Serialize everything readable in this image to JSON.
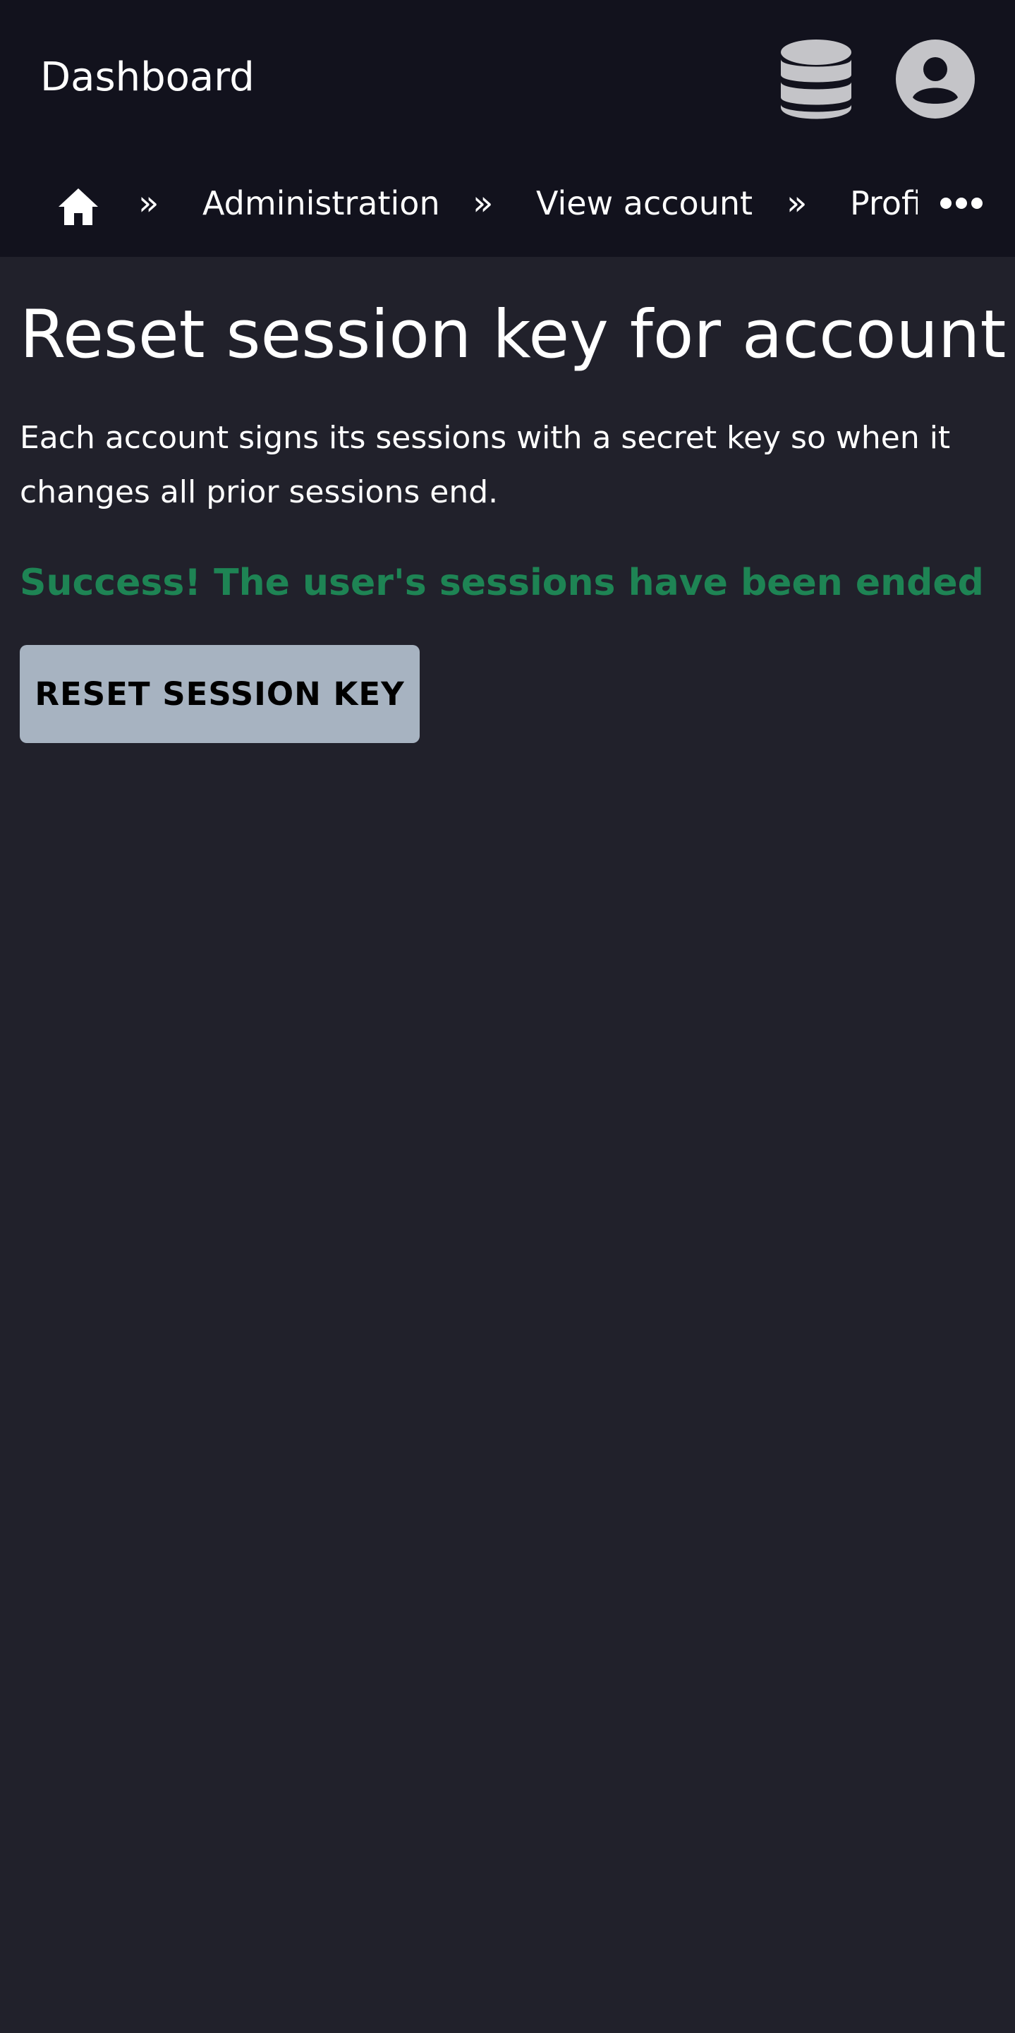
{
  "header": {
    "app_title": "Dashboard",
    "icons": {
      "database": "database-icon",
      "account": "user-circle-icon"
    }
  },
  "breadcrumb": {
    "home_icon": "home-icon",
    "separator": "»",
    "items": [
      {
        "label": "Administration"
      },
      {
        "label": "View account"
      },
      {
        "label": "Profi"
      }
    ],
    "overflow_icon": "more-horizontal-icon"
  },
  "main": {
    "title": "Reset session key for account",
    "description": "Each account signs its sessions with a secret key so when it changes all prior sessions end.",
    "success_message": "Success! The user's sessions have been ended",
    "reset_button_label": "RESET SESSION KEY"
  },
  "colors": {
    "background": "#21212b",
    "header_background": "#12121d",
    "success": "#1e8454",
    "button": "#a7b3c1",
    "icon_gray": "#c4c4c8"
  }
}
